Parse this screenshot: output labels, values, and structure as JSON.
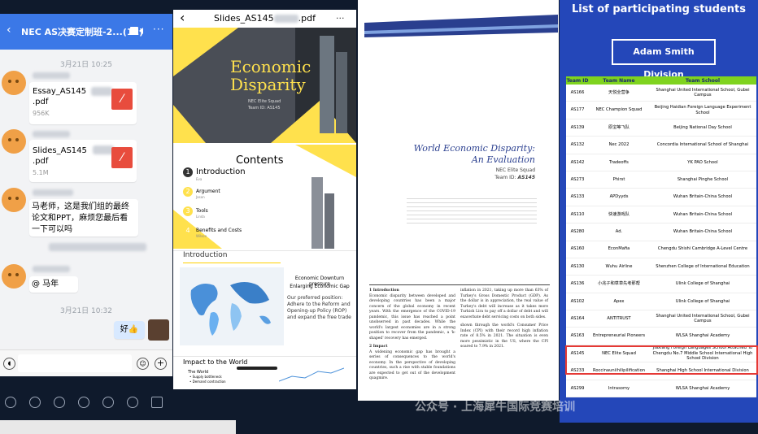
{
  "chat": {
    "title": "NEC AS决赛定制班-2...(12)",
    "time1": "3月21日 10:25",
    "file1_name": "Essay_AS145",
    "file1_ext": ".pdf",
    "file1_size": "956K",
    "file2_name": "Slides_AS145",
    "file2_ext": ".pdf",
    "file2_size": "5.1M",
    "message": "马老师，这是我们组的最终论文和PPT，麻烦您最后看一下可以吗",
    "mention": "@ 马年",
    "time2": "3月21日 10:32",
    "reply": "好👍"
  },
  "slides": {
    "title": "Slides_AS145",
    "title_ext": ".pdf",
    "slide1_title1": "Economic",
    "slide1_title2": "Disparity",
    "slide1_sub1": "NEC Elite Squad",
    "slide1_sub2": "Team ID: AS145",
    "contents_title": "Contents",
    "items": [
      {
        "num": "1",
        "label": "Introduction",
        "sub": "Eva"
      },
      {
        "num": "2",
        "label": "Argument",
        "sub": "Jason"
      },
      {
        "num": "3",
        "label": "Tools",
        "sub": "Linda"
      },
      {
        "num": "4",
        "label": "Benefits and Costs",
        "sub": "Wilson"
      }
    ],
    "intro_title": "Introduction",
    "intro_heading1": "Economic Downturn pressure",
    "intro_heading2": "Enlarging Economic Gap",
    "intro_text": "Our preferred position: Adhere to the Reform and Opening-up Policy (ROP) and expand the free trade",
    "impact_title": "Impact to the World",
    "impact_sub1": "The World",
    "impact_sub2": "• Supply bottleneck",
    "impact_sub3": "• Demand contraction"
  },
  "paper": {
    "title1": "World Economic Disparity:",
    "title2": "An Evaluation",
    "squad": "NEC Elite Squad",
    "team_id_label": "Team ID:",
    "team_id": "AS145",
    "sec1": "1 Introduction",
    "sec2": "2 Impact",
    "p1": "Economic disparity between developed and developing countries has been a major concern of the global economy in recent years. With the emergence of the COVID-19 pandemic, this issue has reached a point unobserved in past decades. While the world's largest economies are in a strong position to recover from the pandemic, a 'k-shaped' recovery has emerged.",
    "p2": "A widening economic gap has brought a series of consequences to the world's economy. In the perspective of developing countries, such a rise with stable foundations are expected to get out of the development quagmire.",
    "p3": "inflation in 2021, taking up more than 63% of Turkey's Gross Domestic Product (GDP). As the dollar is in appreciation, the real value of Turkey's debt will increase as it takes more Turkish Lira to pay off a dollar of debt and will exacerbate debt servicing costs on both sides.",
    "p4": "shown through the world's Consumer Price Index (CPI) with their record high inflation rate of 8.5% in 2021. The situation is even more pessimistic in the US, where the CPI soared to 7.9% in 2021."
  },
  "participants": {
    "heading": "List of participating students",
    "division": "Adam Smith Division",
    "headers": [
      "Team ID",
      "Team Name",
      "Team School"
    ],
    "rows": [
      [
        "AS166",
        "天悦全营争",
        "Shanghai United International School, Gubei Campus"
      ],
      [
        "AS177",
        "NEC Champion Squad",
        "Beijing Haidian Foreign Language Experiment School"
      ],
      [
        "AS139",
        "原宝等飞队",
        "Beijing National Day School"
      ],
      [
        "AS132",
        "Nec 2022",
        "Concordia International School of Shanghai"
      ],
      [
        "AS142",
        "Tradeoffs",
        "YK PAO School"
      ],
      [
        "AS273",
        "Phirst",
        "Shanghai Pinghe School"
      ],
      [
        "AS133",
        "APDyyds",
        "Wuhan Britain-China School"
      ],
      [
        "AS110",
        "快速游戏队",
        "Wuhan Britain-China School"
      ],
      [
        "AS280",
        "Ad.",
        "Wuhan Britain-China School"
      ],
      [
        "AS160",
        "EconMafia",
        "Chengdu Shishi Cambridge A-Level Centre"
      ],
      [
        "AS130",
        "Wuhu Airline",
        "Shenzhen College of International Education"
      ],
      [
        "AS136",
        "小兆子和草草先考那帮",
        "Ulink College of Shanghai"
      ],
      [
        "AS102",
        "Apex",
        "Ulink College of Shanghai"
      ],
      [
        "AS164",
        "ANTITRUST",
        "Shanghai United International School, Gubei Campus"
      ],
      [
        "AS163",
        "Entrepreneurial Pioneers",
        "WLSA Shanghai Academy"
      ],
      [
        "AS145",
        "NEC Elite Squad",
        "Jiaxiang Foreign Languages School Attached To Chengdu No.7 Middle School International High School Division"
      ],
      [
        "AS233",
        "Roccinauniihilipilification",
        "Shanghai High School International Division"
      ],
      [
        "AS299",
        "Intrasomy",
        "WLSA Shanghai Academy"
      ]
    ]
  },
  "watermark": "公众号 · 上海犀牛国际竞赛培训",
  "colors": {
    "chat_header": "#3b78e7",
    "list_bg": "#2447b9",
    "table_header": "#7fd31f",
    "highlight": "#e53935",
    "slide_accent": "#ffe14d"
  }
}
